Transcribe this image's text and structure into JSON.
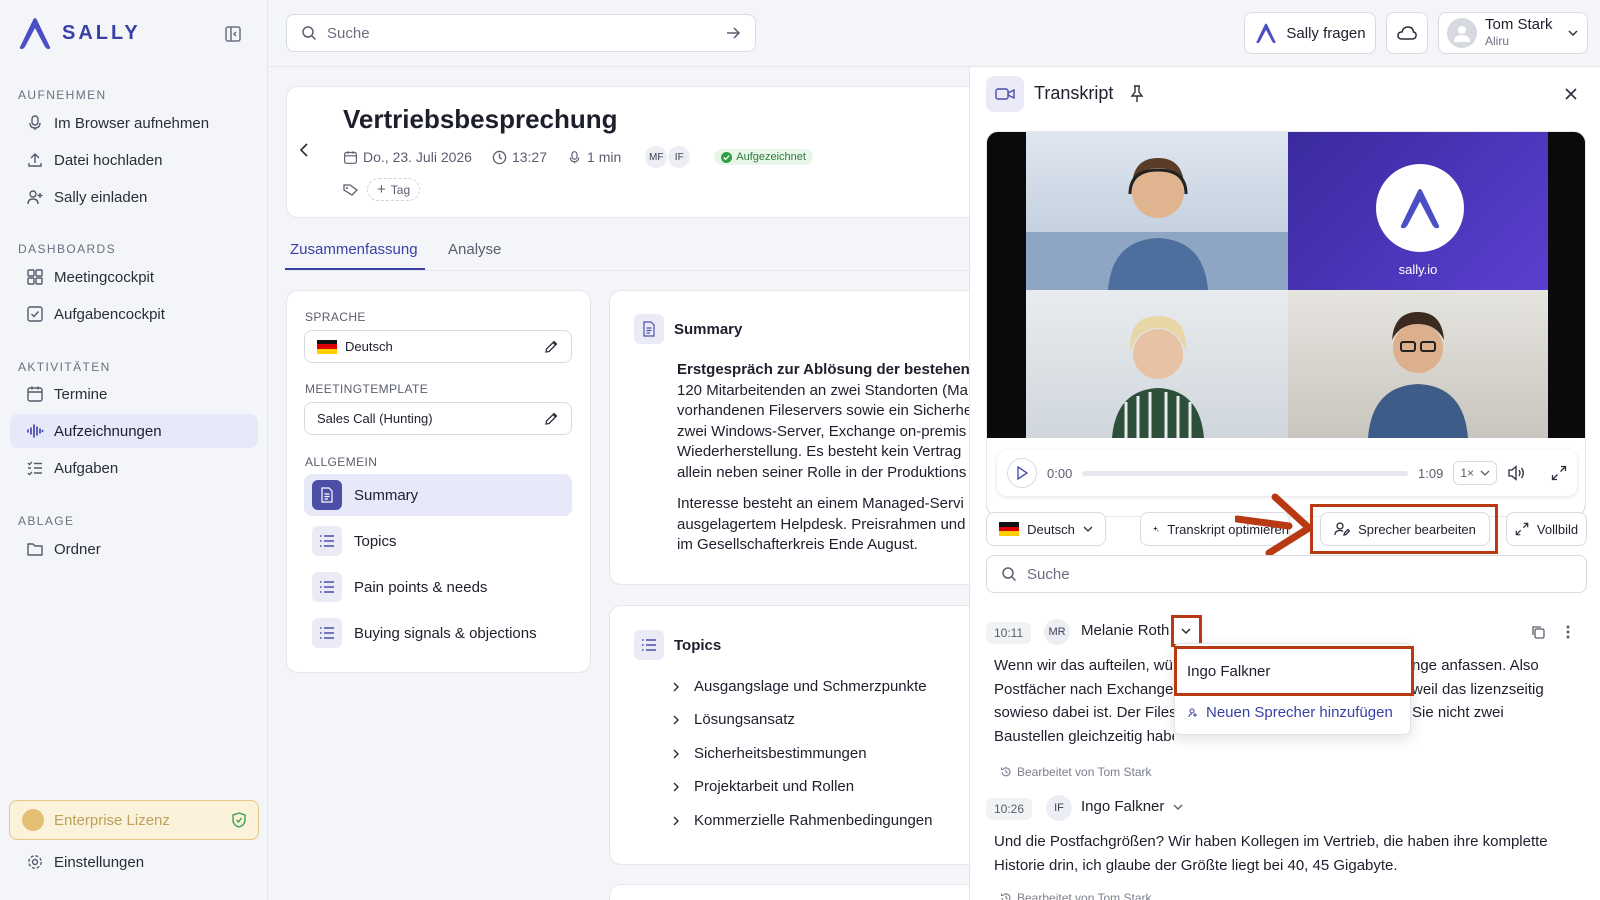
{
  "app": {
    "logo_text": "SALLY"
  },
  "sidebar": {
    "sections": {
      "record": "AUFNEHMEN",
      "dashboards": "DASHBOARDS",
      "activities": "AKTIVITÄTEN",
      "storage": "ABLAGE"
    },
    "items": {
      "browser": "Im Browser aufnehmen",
      "upload": "Datei hochladen",
      "invite": "Sally einladen",
      "meetingcockpit": "Meetingcockpit",
      "taskcockpit": "Aufgabencockpit",
      "dates": "Termine",
      "recordings": "Aufzeichnungen",
      "tasks": "Aufgaben",
      "folder": "Ordner"
    },
    "license": "Enterprise Lizenz",
    "settings": "Einstellungen"
  },
  "topbar": {
    "search_placeholder": "Suche",
    "ask_sally": "Sally fragen",
    "user_name": "Tom Stark",
    "user_org": "Aliru"
  },
  "meeting": {
    "title": "Vertriebsbesprechung",
    "date": "Do., 23. Juli 2026",
    "time": "13:27",
    "duration": "1 min",
    "participant_1": "MF",
    "participant_2": "IF",
    "status": "Aufgezeichnet",
    "tag_button": "Tag"
  },
  "tabs": {
    "summary": "Zusammenfassung",
    "analysis": "Analyse"
  },
  "settings_card": {
    "language_label": "SPRACHE",
    "language_value": "Deutsch",
    "template_label": "MEETINGTEMPLATE",
    "template_value": "Sales Call (Hunting)",
    "general_label": "ALLGEMEIN",
    "sections": [
      "Summary",
      "Topics",
      "Pain points & needs",
      "Buying signals & objections"
    ]
  },
  "summary_card": {
    "title": "Summary",
    "lines_1": [
      "Erstgespräch zur Ablösung der bestehend",
      "120 Mitarbeitenden an zwei Standorten (Ma",
      "vorhandenen Fileservers sowie ein Sicherhe",
      "zwei Windows-Server, Exchange on-premis",
      "Wiederherstellung. Es besteht kein Vertrag",
      "allein neben seiner Rolle in der Produktions"
    ],
    "lines_2": [
      "Interesse besteht an einem Managed-Servi",
      "ausgelagertem Helpdesk. Preisrahmen und",
      "im Gesellschafterkreis Ende August."
    ]
  },
  "topics_card": {
    "title": "Topics",
    "items": [
      "Ausgangslage und Schmerzpunkte",
      "Lösungsansatz",
      "Sicherheitsbestimmungen",
      "Projektarbeit und Rollen",
      "Kommerzielle Rahmenbedingungen"
    ]
  },
  "transcript": {
    "title": "Transkript",
    "player": {
      "current": "0:00",
      "total": "1:09",
      "speed": "1×"
    },
    "video_brand": "sally.io",
    "language": "Deutsch",
    "optimize": "Transkript optimieren",
    "edit_speakers": "Sprecher bearbeiten",
    "fullscreen": "Vollbild",
    "search_placeholder": "Suche",
    "entries": [
      {
        "time": "10:11",
        "initials": "MR",
        "speaker": "Melanie Roth",
        "lines": [
          "Wenn wir das aufteilen, wü",
          "Postfächer nach Exchange",
          "sowieso dabei ist. Der Files",
          "Baustellen gleichzeitig haben."
        ],
        "lines_right": [
          "nge anfassen. Also",
          "weil das lizenzseitig",
          "Sie nicht zwei"
        ],
        "edited": "Bearbeitet von Tom Stark"
      },
      {
        "time": "10:26",
        "initials": "IF",
        "speaker": "Ingo Falkner",
        "lines": [
          "Und die Postfachgrößen? Wir haben Kollegen im Vertrieb, die haben ihre komplette",
          "Historie drin, ich glaube der Größte liegt bei 40, 45 Gigabyte."
        ],
        "edited": "Bearbeitet von Tom Stark"
      }
    ],
    "dropdown": {
      "option": "Ingo Falkner",
      "add": "Neuen Sprecher hinzufügen"
    }
  },
  "colors": {
    "accent": "#3b3fa8",
    "highlight": "#b83a12",
    "status_green": "#2f9e44"
  }
}
